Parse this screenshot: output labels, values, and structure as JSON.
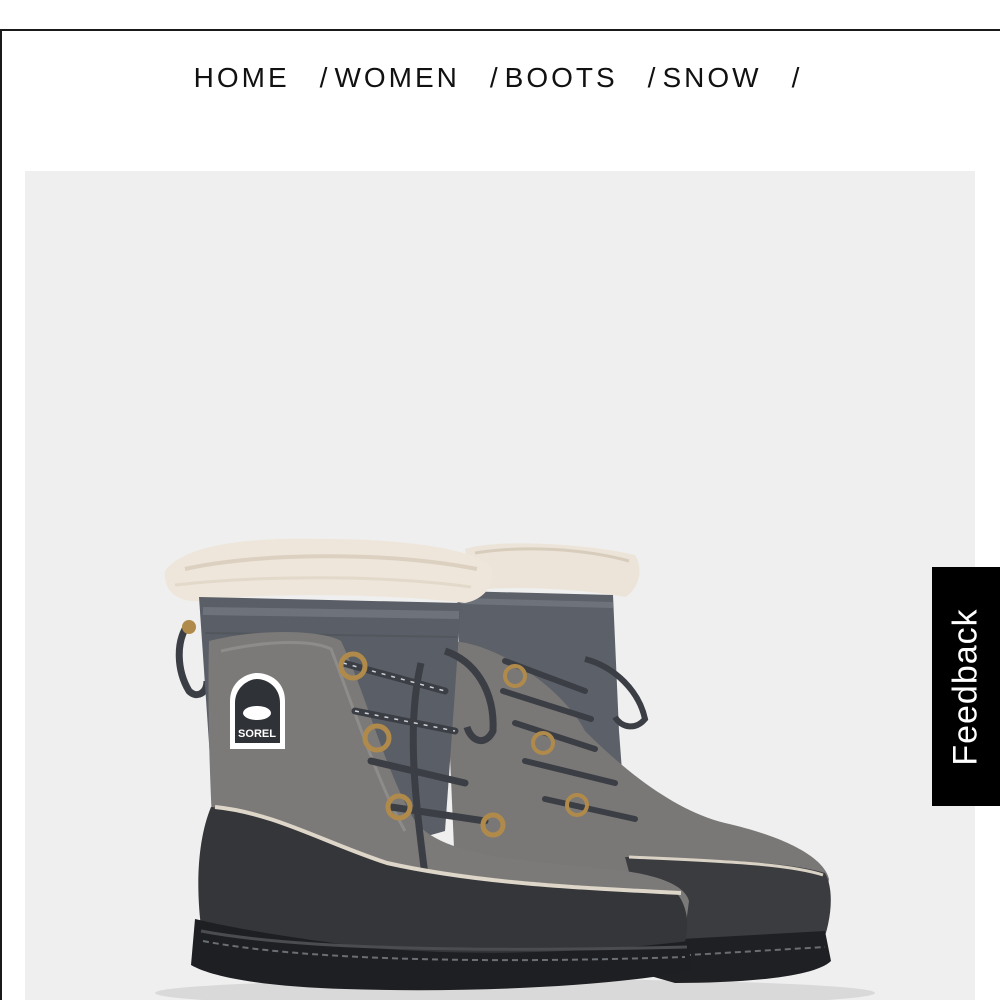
{
  "breadcrumb": {
    "items": [
      {
        "label": "HOME"
      },
      {
        "label": "WOMEN"
      },
      {
        "label": "BOOTS"
      },
      {
        "label": "SNOW"
      }
    ],
    "separator": "/"
  },
  "product_image": {
    "logo_text": "SOREL",
    "background_color": "#efefef"
  },
  "feedback": {
    "label": "Feedback"
  }
}
